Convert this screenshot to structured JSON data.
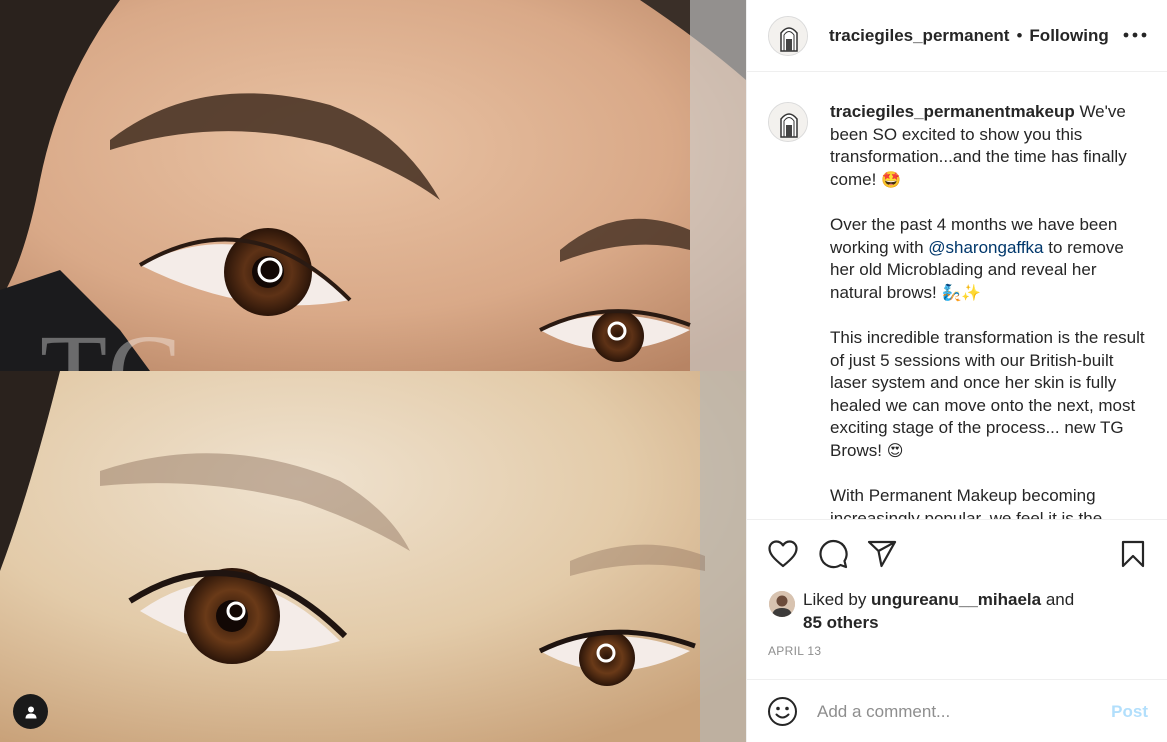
{
  "header": {
    "username": "traciegiles_permanent",
    "separator": "•",
    "follow_state": "Following"
  },
  "caption": {
    "username": "traciegiles_permanentmakeup",
    "p1_text": " We've been SO excited to show you this transformation...and the time has finally come! ",
    "p1_emoji": "🤩",
    "p2_before": "Over the past 4 months we have been working with ",
    "p2_mention": "@sharongaffka",
    "p2_after": " to remove her old Microblading and reveal her natural brows! ",
    "p2_emoji": "🧞✨",
    "p3_text": "This incredible transformation is the result of just 5 sessions with our British-built laser system and once her skin is fully healed we can move onto the next, most exciting stage of the process... new TG Brows! ",
    "p3_emoji": "😍",
    "p4_text": "With Permanent Makeup becoming increasingly popular, we feel it is the"
  },
  "likes": {
    "prefix": "Liked by ",
    "user": "ungureanu__mihaela",
    "middle": " and",
    "others": "85 others"
  },
  "date": "APRIL 13",
  "comment_box": {
    "placeholder": "Add a comment...",
    "post_label": "Post"
  },
  "media": {
    "watermark": "TG"
  },
  "icons": {
    "more": "more-options-icon",
    "like": "heart-icon",
    "comment": "comment-icon",
    "share": "paper-plane-icon",
    "save": "bookmark-icon",
    "emoji": "smiley-icon",
    "user_tag": "user-tag-icon"
  },
  "colors": {
    "text": "#262626",
    "secondary": "#8e8e8e",
    "mention": "#00376b",
    "post_disabled": "#b2dffc",
    "divider": "#efefef"
  }
}
